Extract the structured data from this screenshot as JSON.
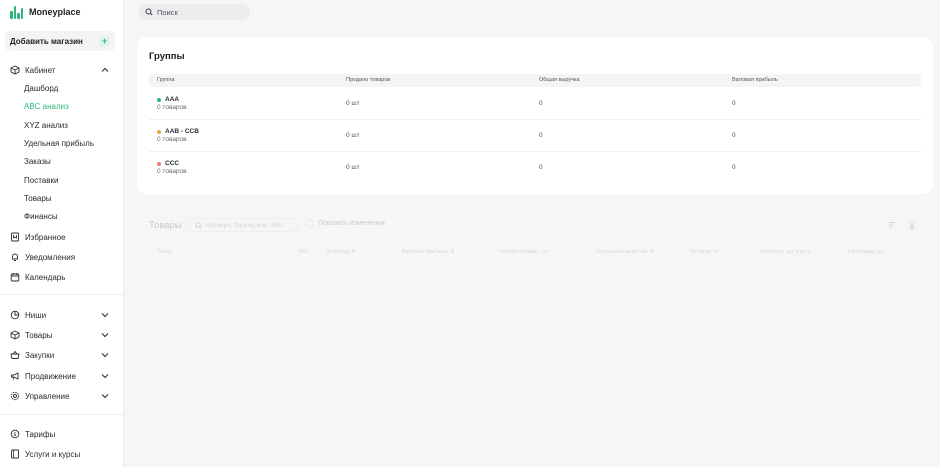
{
  "app": {
    "name": "Moneyplace",
    "brand_color": "#2fb67c"
  },
  "sidebar": {
    "add_store_label": "Добавить магазин",
    "add_store_plus": "+",
    "cabinet": {
      "label": "Кабинет",
      "items": [
        "Дашборд",
        "ABC анализ",
        "XYZ анализ",
        "Удельная прибыль",
        "Заказы",
        "Поставки",
        "Товары",
        "Финансы"
      ],
      "active": "ABC анализ"
    },
    "links": [
      "Избранное",
      "Уведомления",
      "Календарь"
    ],
    "sections": [
      "Ниши",
      "Товары",
      "Закупки",
      "Продвижение",
      "Управление"
    ],
    "bottom": [
      "Тарифы",
      "Услуги и курсы"
    ]
  },
  "search": {
    "placeholder": "Поиск"
  },
  "groups": {
    "title": "Группы",
    "columns": [
      "Группа",
      "Продано товаров",
      "Общая выручка",
      "Валовая прибыль"
    ],
    "rows": [
      {
        "name": "AAA",
        "sub": "0 товаров",
        "sold": "0 шт",
        "revenue": "0",
        "profit": "0",
        "color": "#2fb67c"
      },
      {
        "name": "AAB - CCB",
        "sub": "0 товаров",
        "sold": "0 шт",
        "revenue": "0",
        "profit": "0",
        "color": "#f0a44b"
      },
      {
        "name": "CCC",
        "sub": "0 товаров",
        "sold": "0 шт",
        "revenue": "0",
        "profit": "0",
        "color": "#f07a7a"
      }
    ]
  },
  "products": {
    "title": "Товары",
    "search_placeholder": "Артикул, баркод или SKU",
    "show_changes": "Показать изменения",
    "columns": [
      "Товар",
      "ABC",
      "Выручка, ₽",
      "Валовая прибыль, ₽",
      "Кол-во продаж, шт",
      "Упущенная выручка, ₽",
      "Остатки, %",
      "Скорость, шт в день",
      "На складе, шт"
    ]
  }
}
